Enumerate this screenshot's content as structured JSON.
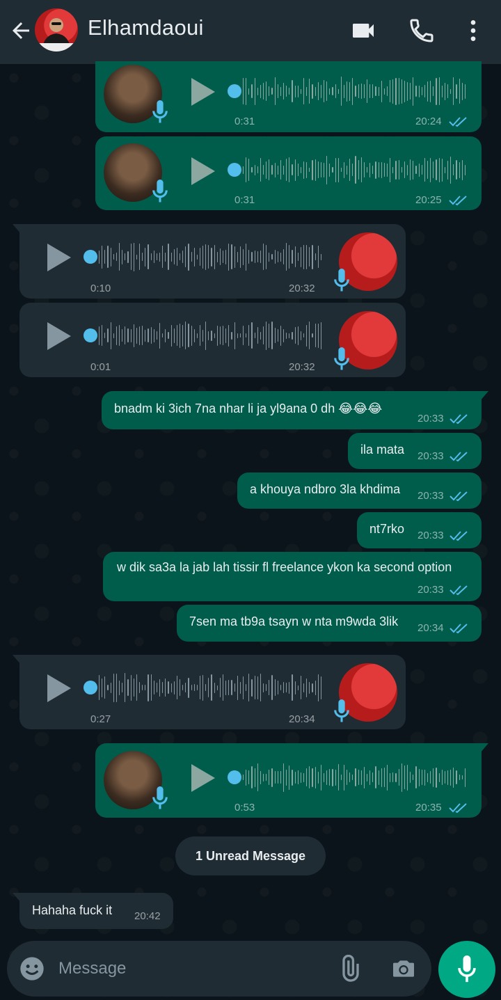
{
  "header": {
    "contact_name": "Elhamdaoui"
  },
  "messages": [
    {
      "type": "voice",
      "direction": "outgoing",
      "duration": "0:31",
      "time": "20:24",
      "status": "read"
    },
    {
      "type": "voice",
      "direction": "outgoing",
      "duration": "0:31",
      "time": "20:25",
      "status": "read"
    },
    {
      "type": "voice",
      "direction": "incoming",
      "duration": "0:10",
      "time": "20:32"
    },
    {
      "type": "voice",
      "direction": "incoming",
      "duration": "0:01",
      "time": "20:32"
    },
    {
      "type": "text",
      "direction": "outgoing",
      "text": "bnadm ki 3ich 7na nhar li ja yl9ana 0 dh 😂😂😂",
      "time": "20:33",
      "status": "read"
    },
    {
      "type": "text",
      "direction": "outgoing",
      "text": "ila mata",
      "time": "20:33",
      "status": "read"
    },
    {
      "type": "text",
      "direction": "outgoing",
      "text": "a khouya ndbro 3la khdima",
      "time": "20:33",
      "status": "read"
    },
    {
      "type": "text",
      "direction": "outgoing",
      "text": "nt7rko",
      "time": "20:33",
      "status": "read"
    },
    {
      "type": "text",
      "direction": "outgoing",
      "text": "w dik sa3a la jab lah tissir fl freelance ykon ka second option",
      "time": "20:33",
      "status": "read"
    },
    {
      "type": "text",
      "direction": "outgoing",
      "text": "7sen ma tb9a tsayn w nta m9wda 3lik",
      "time": "20:34",
      "status": "read"
    },
    {
      "type": "voice",
      "direction": "incoming",
      "duration": "0:27",
      "time": "20:34"
    },
    {
      "type": "voice",
      "direction": "outgoing",
      "duration": "0:53",
      "time": "20:35",
      "status": "read"
    }
  ],
  "unread_divider": "1 Unread Message",
  "incoming_text": {
    "text": "Hahaha fuck it",
    "time": "20:42"
  },
  "composer": {
    "placeholder": "Message"
  },
  "icons": {
    "back": "arrow-left-icon",
    "video": "video-call-icon",
    "call": "phone-icon",
    "menu": "more-vert-icon",
    "emoji": "emoji-icon",
    "attach": "paperclip-icon",
    "camera": "camera-icon",
    "mic": "microphone-icon",
    "play": "play-icon",
    "read": "double-check-icon"
  },
  "colors": {
    "header": "#1f2c34",
    "background": "#0b141a",
    "outgoing_bubble": "#005c4b",
    "incoming_bubble": "#1f2c34",
    "accent": "#00a884",
    "read_ticks": "#53bdeb"
  }
}
